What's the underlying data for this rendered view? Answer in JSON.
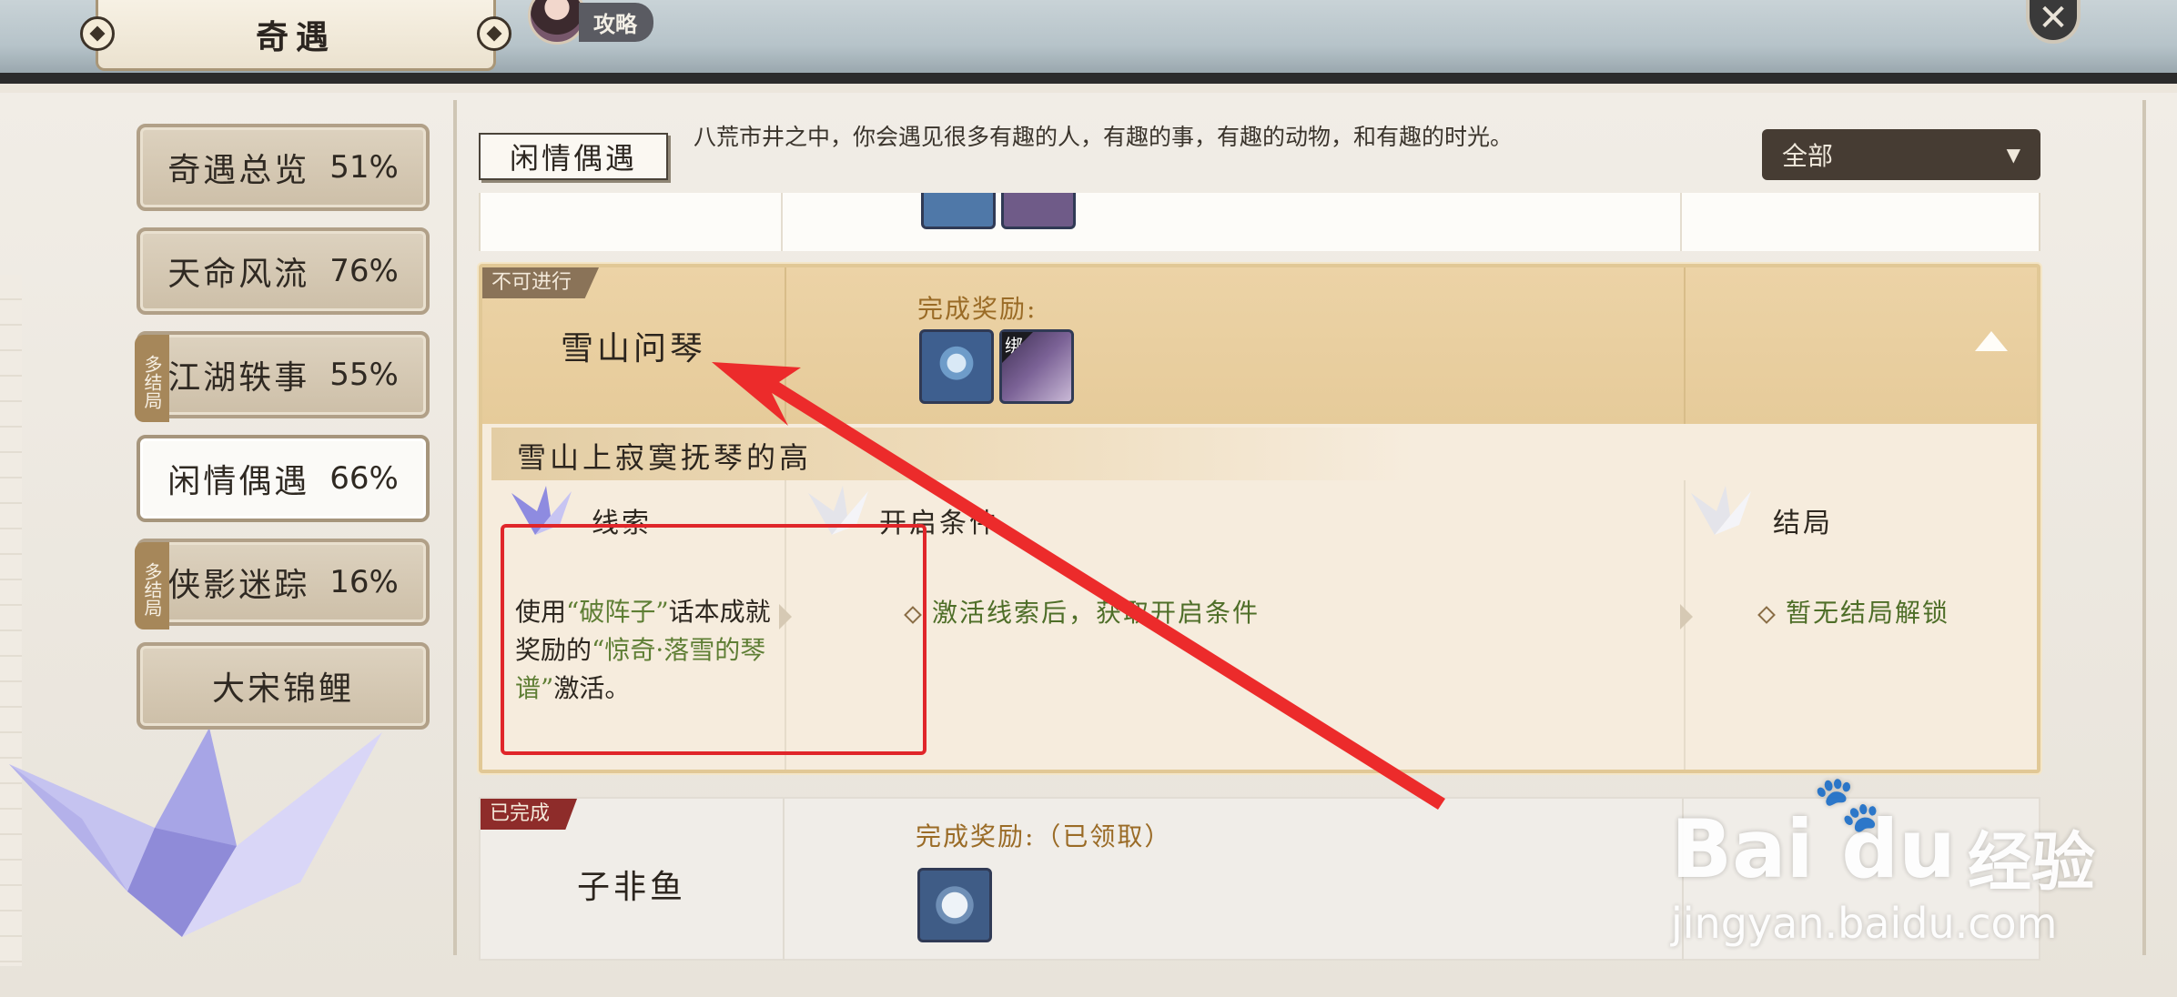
{
  "header": {
    "title": "奇遇",
    "guide_label": "攻略",
    "close_symbol": "✕"
  },
  "sidebar": {
    "items": [
      {
        "label": "奇遇总览",
        "pct": "51%",
        "multi": ""
      },
      {
        "label": "天命风流",
        "pct": "76%",
        "multi": ""
      },
      {
        "label": "江湖轶事",
        "pct": "55%",
        "multi": "多结局"
      },
      {
        "label": "闲情偶遇",
        "pct": "66%",
        "multi": "",
        "active": true
      },
      {
        "label": "侠影迷踪",
        "pct": "16%",
        "multi": "多结局"
      },
      {
        "label": "大宋锦鲤",
        "pct": "",
        "multi": ""
      }
    ]
  },
  "category": {
    "name": "闲情偶遇",
    "description": "八荒市井之中，你会遇见很多有趣的人，有趣的事，有趣的动物，和有趣的时光。"
  },
  "filter": {
    "selected": "全部"
  },
  "current_card": {
    "status": "不可进行",
    "title": "雪山问琴",
    "reward_label": "完成奖励:",
    "bind_tag": "绑",
    "subtitle": "雪山上寂寞抚琴的高",
    "clue_header": "线索",
    "condition_header": "开启条件",
    "ending_header": "结局",
    "clue_text_parts": [
      "使用",
      "“破阵子”",
      "话本成就奖励的",
      "“惊奇·落雪的琴谱”",
      "激活。"
    ],
    "condition_text": "激活线索后，获取开启条件",
    "ending_text": "暂无结局解锁"
  },
  "done_card": {
    "status": "已完成",
    "title": "子非鱼",
    "reward_label": "完成奖励:（已领取）"
  },
  "watermark": {
    "brand": "Bai  du",
    "paw": "🐾",
    "cn": "经验",
    "url": "jingyan.baidu.com"
  },
  "colors": {
    "accent_gold": "#e1c896",
    "highlight_green": "#5e7e34",
    "annotation_red": "#e0262a"
  }
}
